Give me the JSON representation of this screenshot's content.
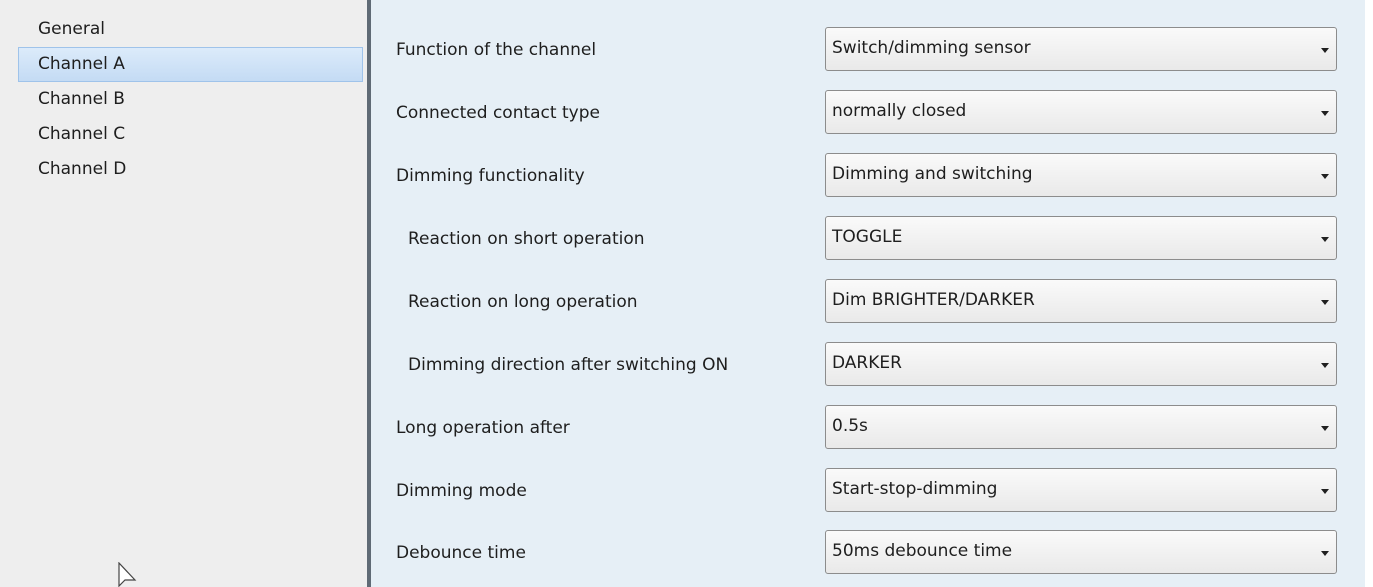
{
  "sidebar": {
    "items": [
      {
        "label": "General"
      },
      {
        "label": "Channel A"
      },
      {
        "label": "Channel B"
      },
      {
        "label": "Channel C"
      },
      {
        "label": "Channel D"
      }
    ],
    "selected": "Channel A"
  },
  "parameters": [
    {
      "label": "Function of the channel",
      "value": "Switch/dimming sensor"
    },
    {
      "label": "Connected contact type",
      "value": "normally closed"
    },
    {
      "label": "Dimming functionality",
      "value": "Dimming and switching"
    },
    {
      "label": "Reaction on short operation",
      "value": "TOGGLE"
    },
    {
      "label": "Reaction on long operation",
      "value": "Dim BRIGHTER/DARKER"
    },
    {
      "label": "Dimming direction after switching ON",
      "value": "DARKER"
    },
    {
      "label": "Long operation after",
      "value": "0.5s"
    },
    {
      "label": "Dimming mode",
      "value": "Start-stop-dimming"
    },
    {
      "label": "Debounce time",
      "value": "50ms debounce time"
    }
  ],
  "colors": {
    "main_background": "#e6eff6",
    "sidebar_background": "#eeeeee",
    "selection_border": "#9fc3ea",
    "splitter": "#5f6a75"
  }
}
